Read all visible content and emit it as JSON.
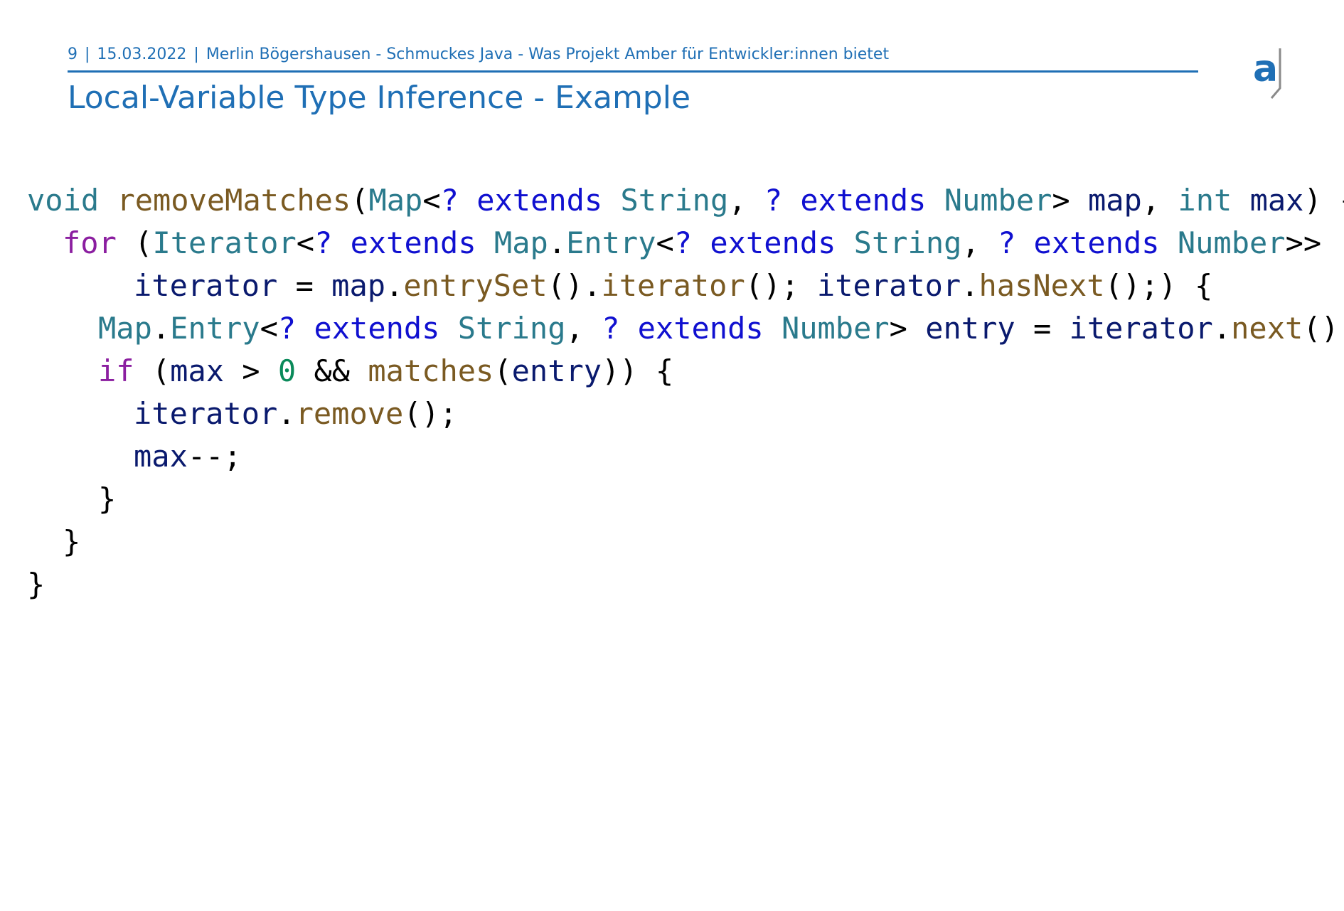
{
  "header": {
    "page_number": "9",
    "date": "15.03.2022",
    "subtitle": "Merlin Bögershausen - Schmuckes Java - Was Projekt Amber für Entwickler:innen bietet",
    "logo_letter": "a"
  },
  "slide": {
    "title": "Local-Variable Type Inference - Example"
  },
  "code": {
    "language": "java",
    "lines": [
      "void removeMatches(Map<? extends String, ? extends Number> map, int max) {",
      "  for (Iterator<? extends Map.Entry<? extends String, ? extends Number>>",
      "      iterator = map.entrySet().iterator(); iterator.hasNext();) {",
      "    Map.Entry<? extends String, ? extends Number> entry = iterator.next();",
      "    if (max > 0 && matches(entry)) {",
      "      iterator.remove();",
      "      max--;",
      "    }",
      "  }",
      "}"
    ]
  },
  "colors": {
    "brand_blue": "#1f6fb5",
    "keyword": "#8b1ea0",
    "type": "#2a7a8c",
    "wildcard": "#1010d0",
    "method": "#7a5a22",
    "variable": "#0a1a6e",
    "number": "#0a8a5a"
  }
}
